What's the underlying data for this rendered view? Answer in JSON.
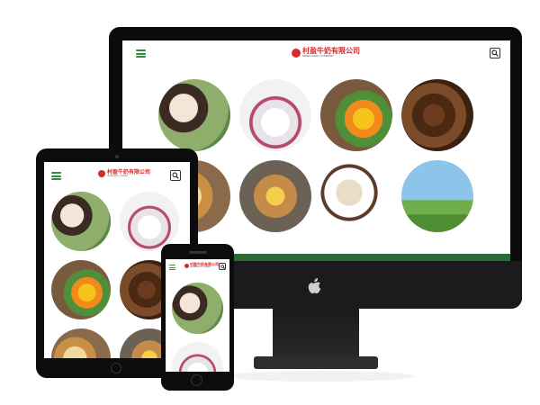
{
  "site": {
    "brand_name": "村盈牛奶有限公司",
    "brand_sub": "MIDEA DAIRY COMPANY",
    "brand_color": "#d42a2a",
    "accent_color": "#2e8b3a",
    "footer_color": "#2e6b34"
  },
  "icons": {
    "menu": "hamburger-menu-icon",
    "search": "search-icon",
    "apple": "apple-logo-icon"
  },
  "products": [
    {
      "label": "",
      "theme": "girl-drinking-milk"
    },
    {
      "label": "",
      "theme": "yogurt-with-berries"
    },
    {
      "label": "",
      "theme": "orange-juice"
    },
    {
      "label": "",
      "theme": "coffee-beans"
    },
    {
      "label": "",
      "theme": "croissant-bread"
    },
    {
      "label": "",
      "theme": "cheese-board"
    },
    {
      "label": "",
      "theme": "sheep-and-cow"
    },
    {
      "label": "",
      "theme": "milk-glass-farm"
    }
  ]
}
